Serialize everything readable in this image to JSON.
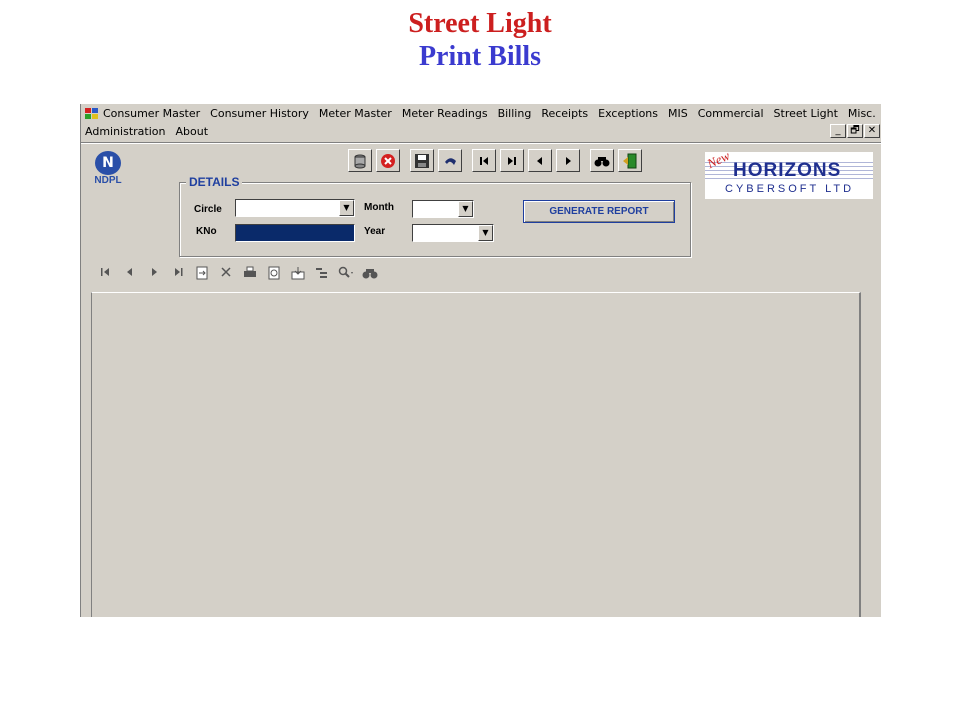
{
  "titles": {
    "line1": "Street Light",
    "line2": "Print Bills"
  },
  "menu": {
    "row1": [
      "Consumer Master",
      "Consumer History",
      "Meter Master",
      "Meter Readings",
      "Billing",
      "Receipts",
      "Exceptions",
      "MIS",
      "Commercial",
      "Street Light",
      "Misc."
    ],
    "row2": [
      "Administration",
      "About"
    ]
  },
  "window_controls": {
    "minimize": "_",
    "restore": "🗗",
    "close": "✕"
  },
  "logos": {
    "ndpl": "NDPL",
    "horizons_new": "New",
    "horizons_big": "HORIZONS",
    "horizons_small": "CYBERSOFT LTD"
  },
  "toolbar": [
    "database-icon",
    "cancel-icon",
    "save-icon",
    "undo-icon",
    "first-icon",
    "last-icon",
    "prev-icon",
    "next-icon",
    "find-icon",
    "exit-icon"
  ],
  "details": {
    "legend": "DETAILS",
    "circle_label": "Circle",
    "circle_value": "",
    "kno_label": "KNo",
    "kno_value": "",
    "month_label": "Month",
    "month_value": "",
    "year_label": "Year",
    "year_value": "",
    "generate_label": "GENERATE REPORT"
  },
  "report_toolbar": [
    "first-page-icon",
    "prev-page-icon",
    "next-page-icon",
    "last-page-icon",
    "goto-page-icon",
    "stop-icon",
    "print-icon",
    "refresh-icon",
    "export-icon",
    "group-tree-icon",
    "zoom-icon",
    "search-text-icon"
  ]
}
